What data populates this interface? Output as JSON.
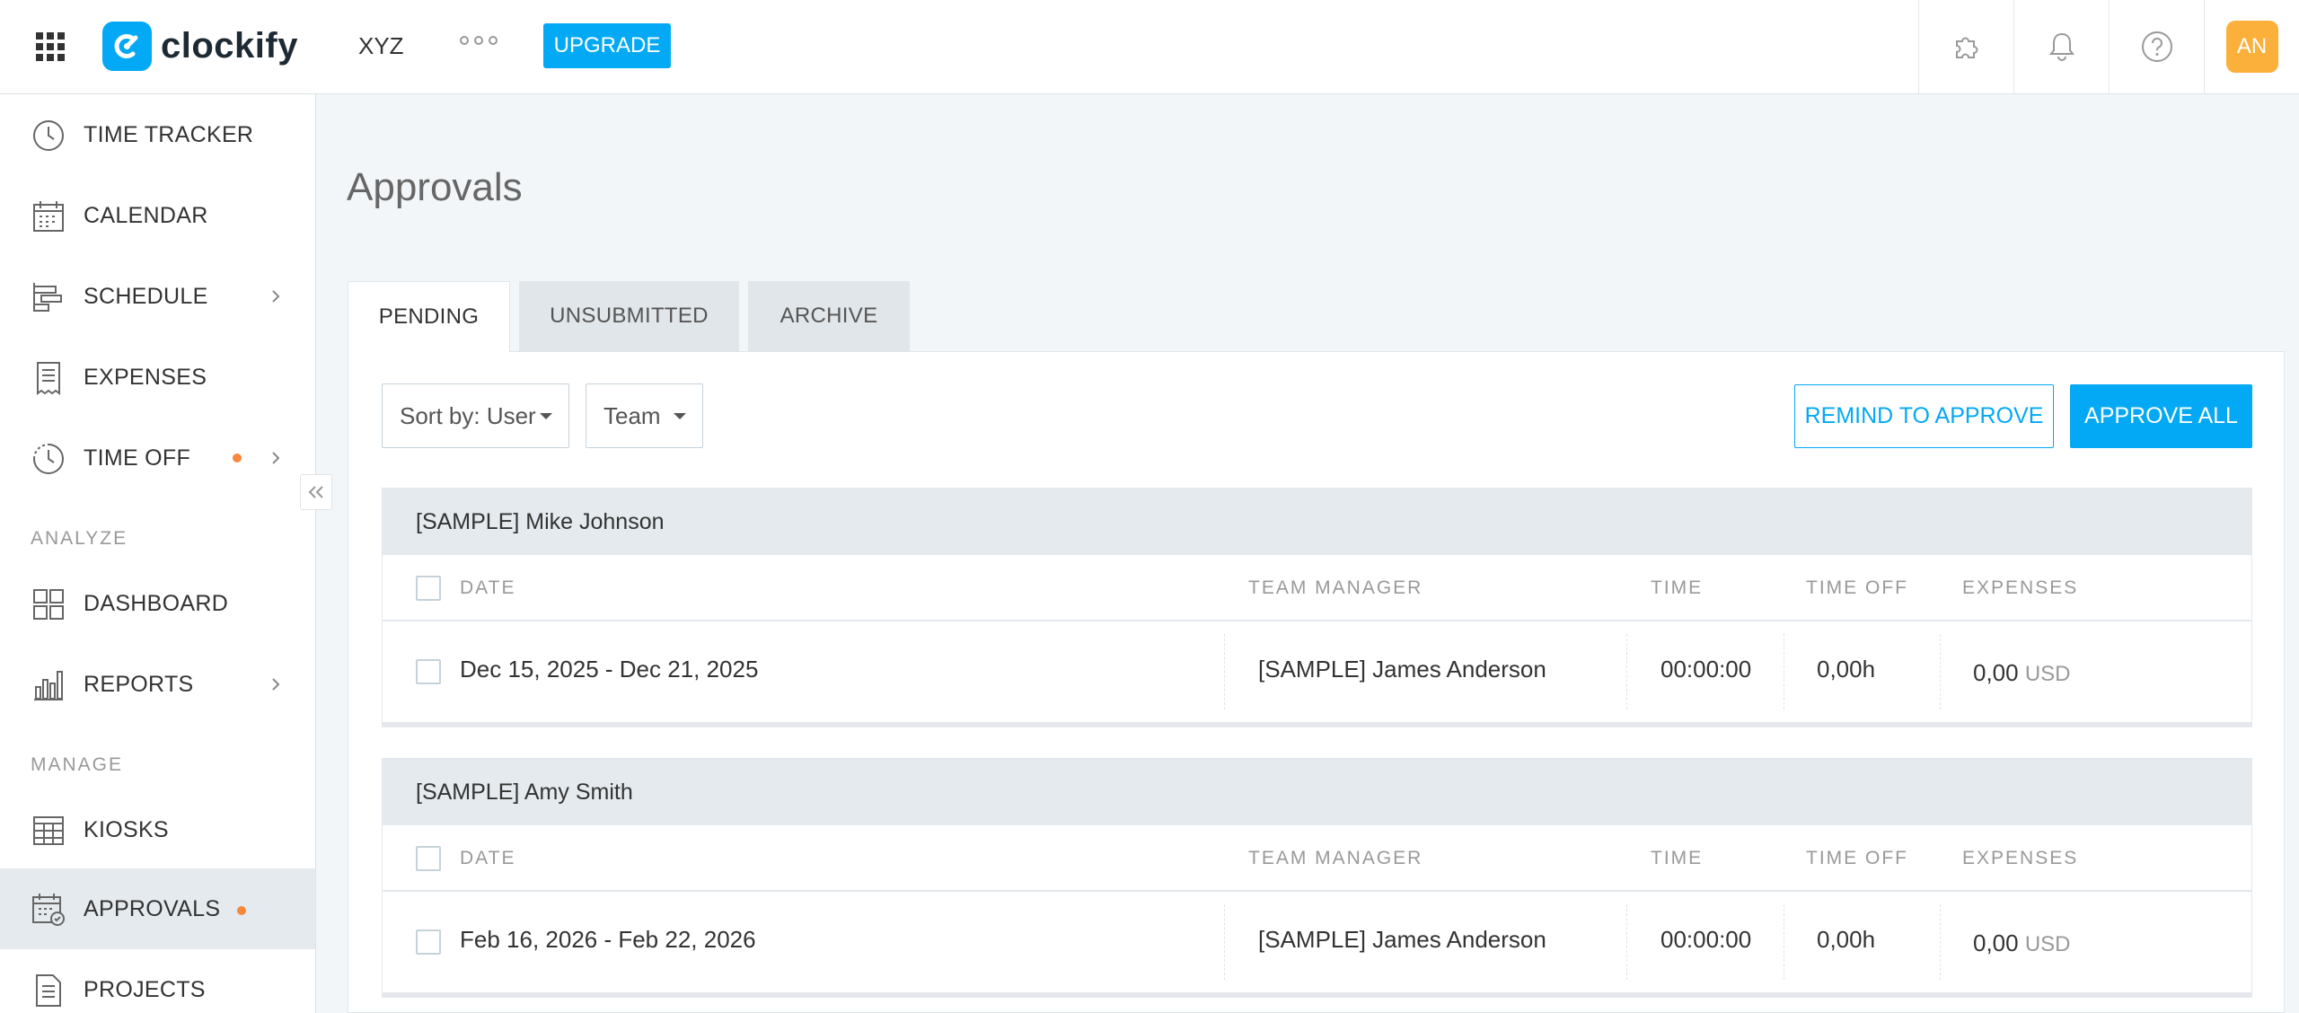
{
  "topbar": {
    "logo_text": "clockify",
    "workspace": "XYZ",
    "upgrade_label": "UPGRADE",
    "avatar_initials": "AN",
    "icons": [
      "apps-grid-icon",
      "more-dots-icon",
      "puzzle-icon",
      "bell-icon",
      "help-icon"
    ]
  },
  "sidebar": {
    "items": [
      {
        "label": "TIME TRACKER",
        "icon": "clock-icon"
      },
      {
        "label": "CALENDAR",
        "icon": "calendar-icon"
      },
      {
        "label": "SCHEDULE",
        "icon": "schedule-icon",
        "has_submenu": true
      },
      {
        "label": "EXPENSES",
        "icon": "receipt-icon"
      },
      {
        "label": "TIME OFF",
        "icon": "time-off-icon",
        "has_submenu": true,
        "badge_dot": true
      },
      {
        "label": "DASHBOARD",
        "icon": "dashboard-icon"
      },
      {
        "label": "REPORTS",
        "icon": "bar-chart-icon",
        "has_submenu": true
      },
      {
        "label": "KIOSKS",
        "icon": "kiosk-icon"
      },
      {
        "label": "APPROVALS",
        "icon": "approvals-icon",
        "active": true,
        "badge_dot": true
      },
      {
        "label": "PROJECTS",
        "icon": "projects-icon"
      }
    ],
    "sections": {
      "analyze": "ANALYZE",
      "manage": "MANAGE"
    },
    "badge_color": "#f6873d"
  },
  "main": {
    "title": "Approvals",
    "tabs": [
      {
        "label": "PENDING",
        "active": true
      },
      {
        "label": "UNSUBMITTED"
      },
      {
        "label": "ARCHIVE"
      }
    ],
    "filters": {
      "sort_label": "Sort by: User",
      "team_label": "Team"
    },
    "actions": {
      "remind_label": "REMIND TO APPROVE",
      "approve_all_label": "APPROVE ALL"
    },
    "columns": {
      "date": "DATE",
      "team_manager": "TEAM MANAGER",
      "time": "TIME",
      "time_off": "TIME OFF",
      "expenses": "EXPENSES"
    },
    "groups": [
      {
        "user": "[SAMPLE] Mike Johnson",
        "rows": [
          {
            "date": "Dec 15, 2025 - Dec 21, 2025",
            "manager": "[SAMPLE] James Anderson",
            "time": "00:00:00",
            "time_off": "0,00h",
            "expenses": "0,00",
            "currency": "USD"
          }
        ]
      },
      {
        "user": "[SAMPLE] Amy Smith",
        "rows": [
          {
            "date": "Feb 16, 2026 - Feb 22, 2026",
            "manager": "[SAMPLE] James Anderson",
            "time": "00:00:00",
            "time_off": "0,00h",
            "expenses": "0,00",
            "currency": "USD"
          }
        ]
      }
    ]
  },
  "colors": {
    "accent": "#03a9f4",
    "avatar_bg": "#fbb03b",
    "active_nav_bg": "#e4eaee"
  }
}
